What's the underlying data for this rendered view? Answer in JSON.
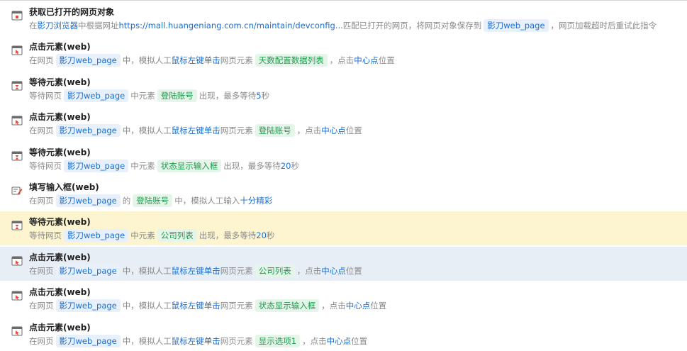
{
  "colors": {
    "link": "#1a6fcf",
    "tag_blue_bg": "#e7f0fb",
    "tag_green_text": "#1e9a4c",
    "tag_green_bg": "#e5f5ea",
    "highlight_yellow": "#fdf5d0",
    "highlight_blue": "#e8eef6"
  },
  "steps": [
    {
      "icon": "browser-window-icon",
      "title": "获取已打开的网页对象",
      "highlight": "none",
      "desc": [
        {
          "t": "在 ",
          "k": "text"
        },
        {
          "t": "影刀浏览器",
          "k": "link"
        },
        {
          "t": " 中根据网址 ",
          "k": "text"
        },
        {
          "t": "https://mall.huangeniang.com.cn/maintain/devconfig...",
          "k": "link"
        },
        {
          "t": " 匹配已打开的网页，将网页对象保存到 ",
          "k": "text"
        },
        {
          "t": "影刀web_page",
          "k": "tag-blue"
        },
        {
          "t": "，网页加载超时后重试此指令",
          "k": "text"
        }
      ]
    },
    {
      "icon": "click-element-icon",
      "title": "点击元素(web)",
      "highlight": "none",
      "desc": [
        {
          "t": "在网页 ",
          "k": "text"
        },
        {
          "t": "影刀web_page",
          "k": "tag-blue"
        },
        {
          "t": " 中，模拟人工 ",
          "k": "text"
        },
        {
          "t": "鼠标左键",
          "k": "link"
        },
        {
          "t": " ",
          "k": "text"
        },
        {
          "t": "单击",
          "k": "link"
        },
        {
          "t": " 网页元素 ",
          "k": "text"
        },
        {
          "t": "天数配置数据列表",
          "k": "tag-green"
        },
        {
          "t": "，点击 ",
          "k": "text"
        },
        {
          "t": "中心点",
          "k": "link"
        },
        {
          "t": " 位置",
          "k": "text"
        }
      ]
    },
    {
      "icon": "hourglass-icon",
      "title": "等待元素(web)",
      "highlight": "none",
      "desc": [
        {
          "t": "等待网页 ",
          "k": "text"
        },
        {
          "t": "影刀web_page",
          "k": "tag-blue"
        },
        {
          "t": " 中元素 ",
          "k": "text"
        },
        {
          "t": "登陆账号",
          "k": "tag-green"
        },
        {
          "t": " 出现，最多等待 ",
          "k": "text"
        },
        {
          "t": "5",
          "k": "link"
        },
        {
          "t": " 秒",
          "k": "text"
        }
      ]
    },
    {
      "icon": "click-element-icon",
      "title": "点击元素(web)",
      "highlight": "none",
      "desc": [
        {
          "t": "在网页 ",
          "k": "text"
        },
        {
          "t": "影刀web_page",
          "k": "tag-blue"
        },
        {
          "t": " 中，模拟人工 ",
          "k": "text"
        },
        {
          "t": "鼠标左键",
          "k": "link"
        },
        {
          "t": " ",
          "k": "text"
        },
        {
          "t": "单击",
          "k": "link"
        },
        {
          "t": " 网页元素 ",
          "k": "text"
        },
        {
          "t": "登陆账号",
          "k": "tag-green"
        },
        {
          "t": "，点击 ",
          "k": "text"
        },
        {
          "t": "中心点",
          "k": "link"
        },
        {
          "t": " 位置",
          "k": "text"
        }
      ]
    },
    {
      "icon": "hourglass-icon",
      "title": "等待元素(web)",
      "highlight": "none",
      "desc": [
        {
          "t": "等待网页 ",
          "k": "text"
        },
        {
          "t": "影刀web_page",
          "k": "tag-blue"
        },
        {
          "t": " 中元素 ",
          "k": "text"
        },
        {
          "t": "状态显示输入框",
          "k": "tag-green"
        },
        {
          "t": " 出现，最多等待 ",
          "k": "text"
        },
        {
          "t": "20",
          "k": "link"
        },
        {
          "t": " 秒",
          "k": "text"
        }
      ]
    },
    {
      "icon": "fill-input-icon",
      "title": "填写输入框(web)",
      "highlight": "none",
      "desc": [
        {
          "t": "在网页 ",
          "k": "text"
        },
        {
          "t": "影刀web_page",
          "k": "tag-blue"
        },
        {
          "t": " 的 ",
          "k": "text"
        },
        {
          "t": "登陆账号",
          "k": "tag-green"
        },
        {
          "t": " 中，模拟人工输入 ",
          "k": "text"
        },
        {
          "t": "十分精彩",
          "k": "link"
        }
      ]
    },
    {
      "icon": "hourglass-icon",
      "title": "等待元素(web)",
      "highlight": "yellow",
      "desc": [
        {
          "t": "等待网页 ",
          "k": "text"
        },
        {
          "t": "影刀web_page",
          "k": "tag-blue"
        },
        {
          "t": " 中元素 ",
          "k": "text"
        },
        {
          "t": "公司列表",
          "k": "tag-green"
        },
        {
          "t": " 出现，最多等待 ",
          "k": "text"
        },
        {
          "t": "20",
          "k": "link"
        },
        {
          "t": " 秒",
          "k": "text"
        }
      ]
    },
    {
      "icon": "click-element-icon",
      "title": "点击元素(web)",
      "highlight": "blue",
      "desc": [
        {
          "t": "在网页 ",
          "k": "text"
        },
        {
          "t": "影刀web_page",
          "k": "tag-blue"
        },
        {
          "t": " 中，模拟人工 ",
          "k": "text"
        },
        {
          "t": "鼠标左键",
          "k": "link"
        },
        {
          "t": " ",
          "k": "text"
        },
        {
          "t": "单击",
          "k": "link"
        },
        {
          "t": " 网页元素 ",
          "k": "text"
        },
        {
          "t": "公司列表",
          "k": "tag-green"
        },
        {
          "t": "，点击 ",
          "k": "text"
        },
        {
          "t": "中心点",
          "k": "link"
        },
        {
          "t": " 位置",
          "k": "text"
        }
      ]
    },
    {
      "icon": "click-element-icon",
      "title": "点击元素(web)",
      "highlight": "none",
      "desc": [
        {
          "t": "在网页 ",
          "k": "text"
        },
        {
          "t": "影刀web_page",
          "k": "tag-blue"
        },
        {
          "t": " 中，模拟人工 ",
          "k": "text"
        },
        {
          "t": "鼠标左键",
          "k": "link"
        },
        {
          "t": " ",
          "k": "text"
        },
        {
          "t": "单击",
          "k": "link"
        },
        {
          "t": " 网页元素 ",
          "k": "text"
        },
        {
          "t": "状态显示输入框",
          "k": "tag-green"
        },
        {
          "t": "，点击 ",
          "k": "text"
        },
        {
          "t": "中心点",
          "k": "link"
        },
        {
          "t": " 位置",
          "k": "text"
        }
      ]
    },
    {
      "icon": "click-element-icon",
      "title": "点击元素(web)",
      "highlight": "none",
      "desc": [
        {
          "t": "在网页 ",
          "k": "text"
        },
        {
          "t": "影刀web_page",
          "k": "tag-blue"
        },
        {
          "t": " 中，模拟人工 ",
          "k": "text"
        },
        {
          "t": "鼠标左键",
          "k": "link"
        },
        {
          "t": " ",
          "k": "text"
        },
        {
          "t": "单击",
          "k": "link"
        },
        {
          "t": " 网页元素 ",
          "k": "text"
        },
        {
          "t": "显示选项1",
          "k": "tag-green"
        },
        {
          "t": "，点击 ",
          "k": "text"
        },
        {
          "t": "中心点",
          "k": "link"
        },
        {
          "t": " 位置",
          "k": "text"
        }
      ]
    }
  ]
}
